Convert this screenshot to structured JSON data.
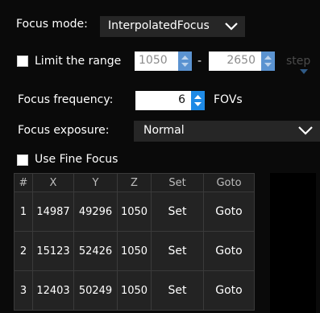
{
  "focus_mode": {
    "label": "Focus mode:",
    "value": "InterpolatedFocus"
  },
  "limit_range": {
    "label": "Limit the range",
    "from": "1050",
    "separator": "-",
    "to": "2650",
    "step_label": "step"
  },
  "focus_frequency": {
    "label": "Focus frequency:",
    "value": "6",
    "unit": "FOVs"
  },
  "focus_exposure": {
    "label": "Focus exposure:",
    "value": "Normal"
  },
  "fine_focus": {
    "label": "Use Fine Focus"
  },
  "table": {
    "headers": [
      "#",
      "X",
      "Y",
      "Z",
      "Set",
      "Goto"
    ],
    "rows": [
      {
        "idx": "1",
        "x": "14987",
        "y": "49296",
        "z": "1050",
        "set": "Set",
        "goto": "Goto"
      },
      {
        "idx": "2",
        "x": "15123",
        "y": "52426",
        "z": "1050",
        "set": "Set",
        "goto": "Goto"
      },
      {
        "idx": "3",
        "x": "12403",
        "y": "50249",
        "z": "1050",
        "set": "Set",
        "goto": "Goto"
      }
    ]
  },
  "icons": {
    "dropdown": "chevron-down-icon",
    "spinner": "spinner-arrows-icon"
  },
  "colors": {
    "background": "#0a0a0a",
    "field": "#262626",
    "spinner_accent": "#1e8ae6",
    "spinner_muted": "#5b93d1",
    "disabled_text": "#4b4b4b"
  }
}
